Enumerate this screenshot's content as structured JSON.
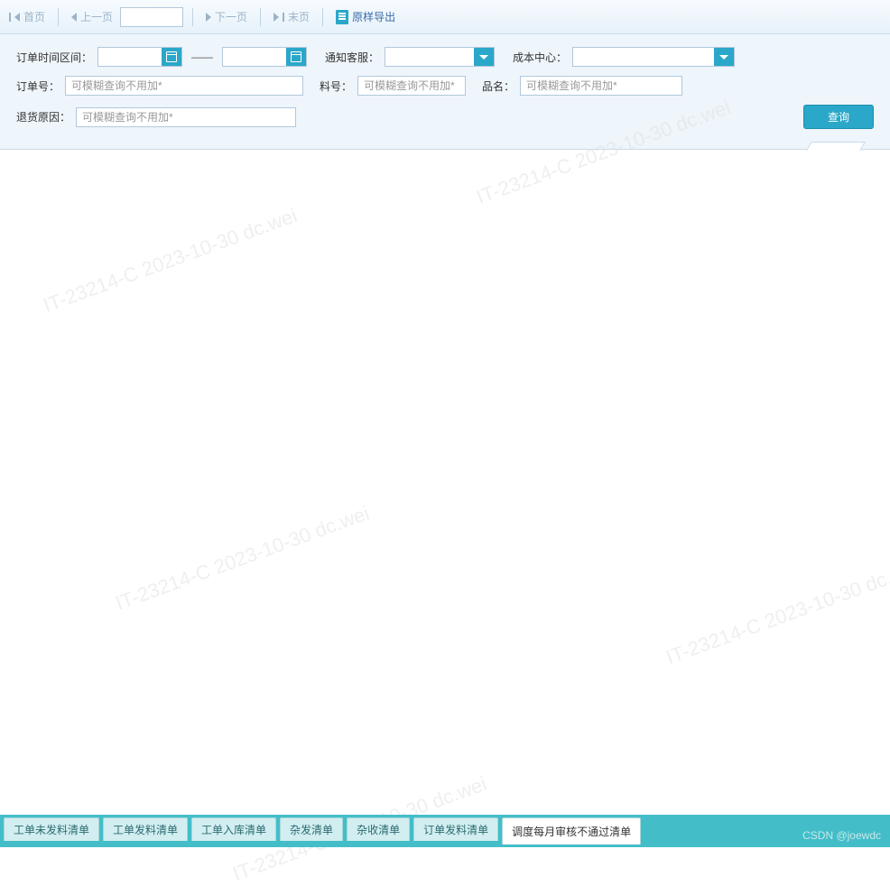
{
  "pager": {
    "first": "首页",
    "prev": "上一页",
    "page_value": "",
    "next": "下一页",
    "last": "末页",
    "export": "原样导出"
  },
  "filters": {
    "order_time_label": "订单时间区间：",
    "range_sep": "——",
    "notify_cs_label": "通知客服：",
    "cost_center_label": "成本中心：",
    "order_no_label": "订单号：",
    "material_no_label": "料号：",
    "product_name_label": "品名：",
    "return_reason_label": "退货原因：",
    "fuzzy_placeholder": "可模糊查询不用加*",
    "query_btn": "查询"
  },
  "tabs": [
    {
      "label": "工单未发料清单",
      "active": false
    },
    {
      "label": "工单发料清单",
      "active": false
    },
    {
      "label": "工单入库清单",
      "active": false
    },
    {
      "label": "杂发清单",
      "active": false
    },
    {
      "label": "杂收清单",
      "active": false
    },
    {
      "label": "订单发料清单",
      "active": false
    },
    {
      "label": "调度每月审核不通过清单",
      "active": true
    }
  ],
  "watermark_text": "IT-23214-C  2023-10-30  dc.wei",
  "footer_credit": "CSDN @joewdc"
}
